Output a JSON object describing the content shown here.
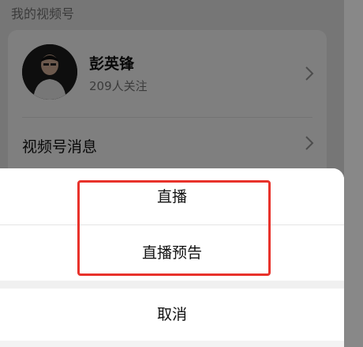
{
  "background": {
    "section_title": "我的视频号",
    "profile": {
      "name": "彭英锋",
      "followers": "209人关注"
    },
    "messages_label": "视频号消息"
  },
  "sheet": {
    "live_label": "直播",
    "preview_label": "直播预告",
    "cancel_label": "取消"
  },
  "colors": {
    "highlight": "#e8322b",
    "overlay": "rgba(0,0,0,0.5)"
  }
}
